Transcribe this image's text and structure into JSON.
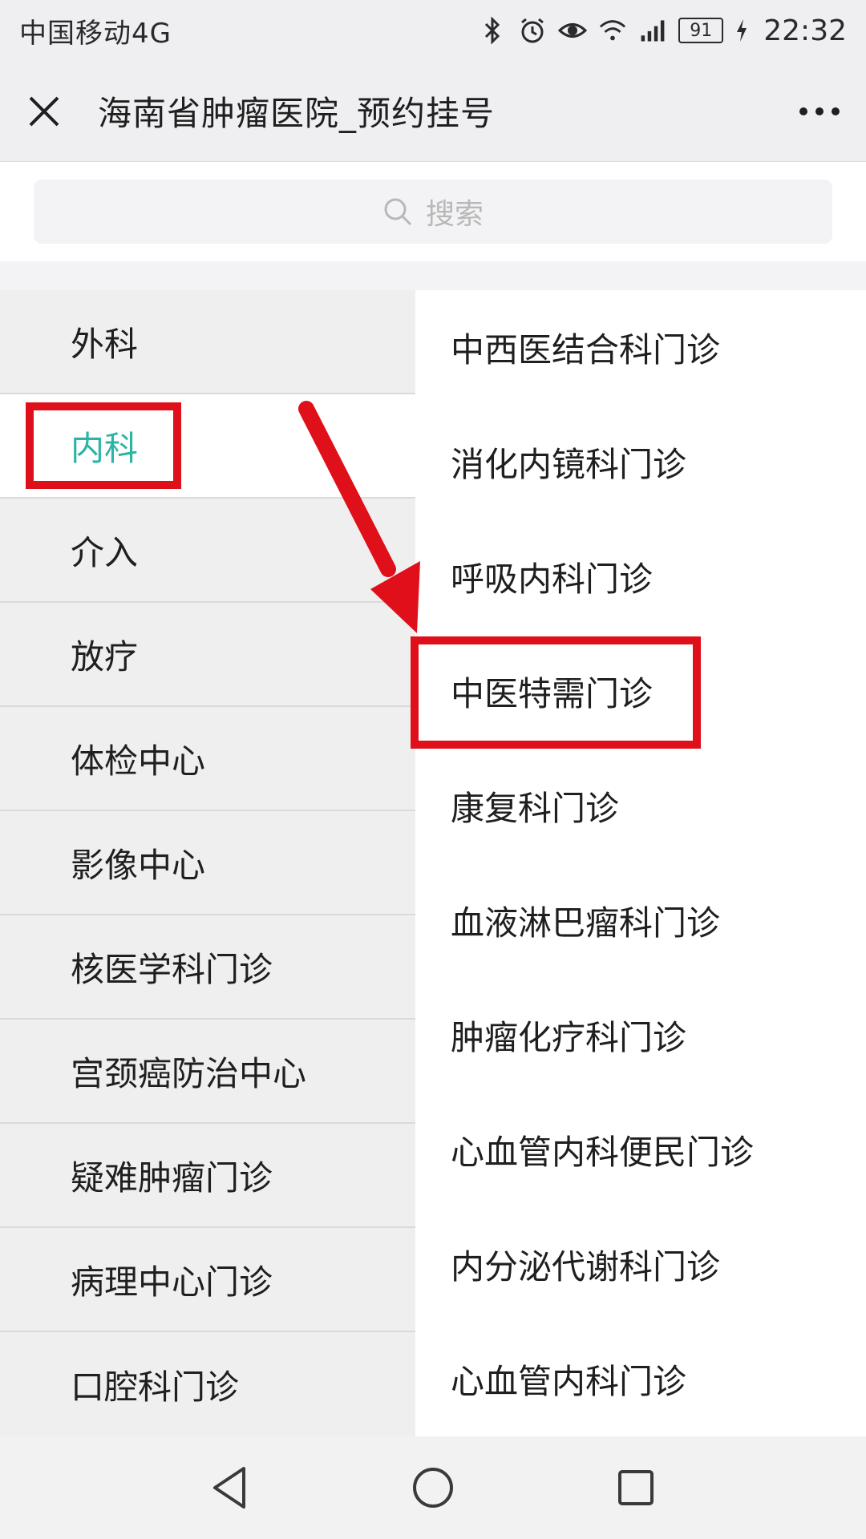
{
  "status_bar": {
    "carrier": "中国移动4G",
    "battery": "91",
    "time": "22:32",
    "icons": [
      "bluetooth-icon",
      "alarm-icon",
      "eye-icon",
      "wifi-icon",
      "signal-icon",
      "charging-icon"
    ]
  },
  "title_bar": {
    "title": "海南省肿瘤医院_预约挂号"
  },
  "search": {
    "placeholder": "搜索"
  },
  "categories": [
    {
      "label": "外科"
    },
    {
      "label": "内科",
      "active": true
    },
    {
      "label": "介入"
    },
    {
      "label": "放疗"
    },
    {
      "label": "体检中心"
    },
    {
      "label": "影像中心"
    },
    {
      "label": "核医学科门诊"
    },
    {
      "label": "宫颈癌防治中心"
    },
    {
      "label": "疑难肿瘤门诊"
    },
    {
      "label": "病理中心门诊"
    },
    {
      "label": "口腔科门诊"
    }
  ],
  "departments": [
    {
      "label": "中西医结合科门诊"
    },
    {
      "label": "消化内镜科门诊"
    },
    {
      "label": "呼吸内科门诊"
    },
    {
      "label": "中医特需门诊",
      "highlighted": true
    },
    {
      "label": "康复科门诊"
    },
    {
      "label": "血液淋巴瘤科门诊"
    },
    {
      "label": "肿瘤化疗科门诊"
    },
    {
      "label": "心血管内科便民门诊"
    },
    {
      "label": "内分泌代谢科门诊"
    },
    {
      "label": "心血管内科门诊"
    }
  ],
  "colors": {
    "accent": "#2bb5a6",
    "annotation": "#e0101a"
  }
}
